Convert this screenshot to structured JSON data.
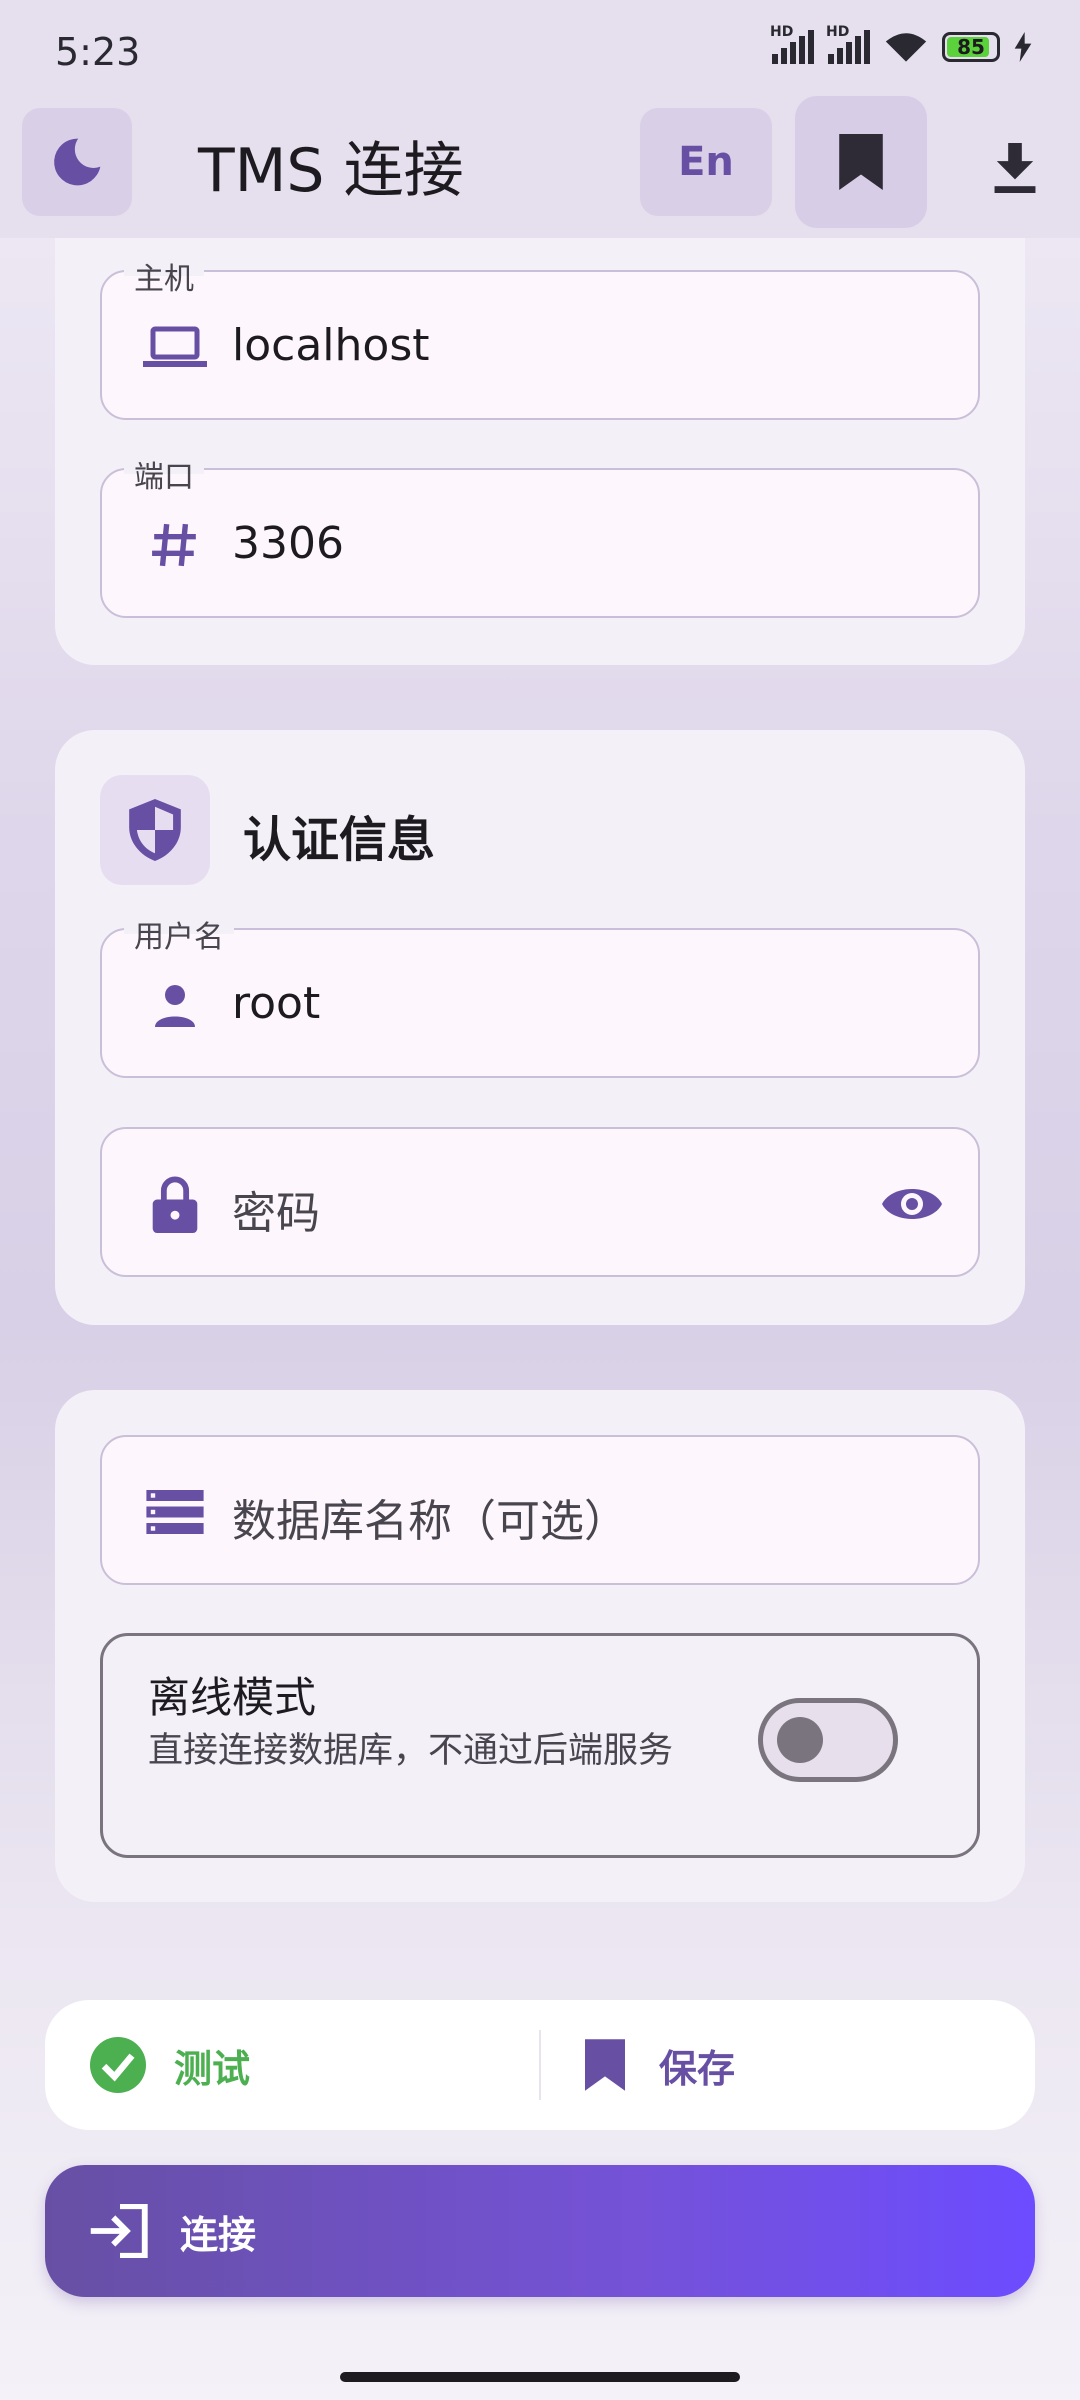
{
  "status_bar": {
    "time": "5:23",
    "battery": "85"
  },
  "app_bar": {
    "title": "TMS 连接",
    "lang_label": "En"
  },
  "connection": {
    "host": {
      "label": "主机",
      "value": "localhost"
    },
    "port": {
      "label": "端口",
      "value": "3306"
    }
  },
  "auth": {
    "title": "认证信息",
    "username": {
      "label": "用户名",
      "value": "root"
    },
    "password": {
      "placeholder": "密码"
    }
  },
  "database": {
    "name_placeholder": "数据库名称（可选）",
    "offline_title": "离线模式",
    "offline_desc": "直接连接数据库，不通过后端服务",
    "offline_enabled": false
  },
  "actions": {
    "test_label": "测试",
    "save_label": "保存",
    "connect_label": "连接"
  },
  "colors": {
    "primary": "#6750a4",
    "success": "#4caf50",
    "gradient_end": "#6c4cff"
  },
  "icons": {
    "theme": "moon-icon",
    "bookmark": "bookmark-icon",
    "download": "download-icon",
    "host": "laptop-icon",
    "port": "hash-icon",
    "auth": "shield-icon",
    "user": "person-icon",
    "password": "lock-icon",
    "visibility": "eye-icon",
    "database": "storage-icon",
    "test": "check-circle-icon",
    "connect": "login-icon"
  }
}
